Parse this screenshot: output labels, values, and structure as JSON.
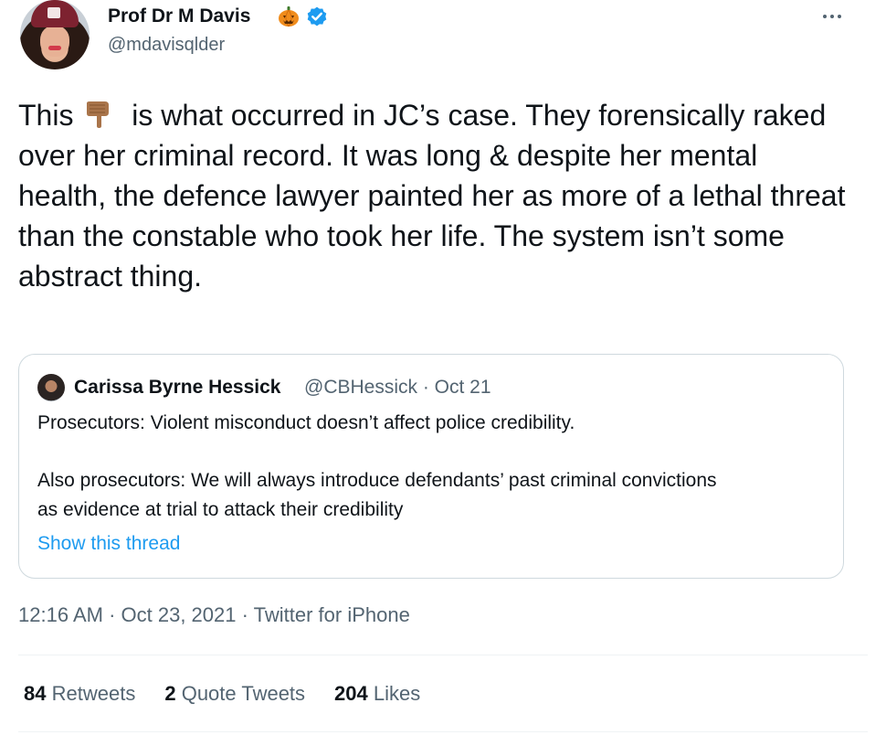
{
  "author": {
    "display_name": "Prof Dr M Davis",
    "handle": "@mdavisqlder",
    "badges": [
      "pumpkin-emoji",
      "verified-badge"
    ],
    "verified_color": "#1d9bf0"
  },
  "tweet": {
    "text_before_emoji": "This",
    "emoji": "backhand-index-pointing-down",
    "text_after_emoji": " is what occurred in JC’s case. They forensically raked over her criminal record. It was long & despite her mental health, the defence lawyer painted her as more of a lethal threat than the constable who took her life. The system isn’t some abstract thing."
  },
  "quoted_tweet": {
    "author_name": "Carissa Byrne Hessick",
    "meta": "@CBHessick · Oct 21",
    "line1": "Prosecutors: Violent misconduct doesn’t affect police credibility.",
    "line2": "Also prosecutors: We will always introduce defendants’ past criminal convictions",
    "line3": "as evidence at trial to attack their credibility",
    "show_thread": "Show this thread"
  },
  "meta": {
    "time": "12:16 AM",
    "date": "Oct 23, 2021",
    "source": "Twitter for iPhone",
    "separator": " · "
  },
  "stats": {
    "retweets_count": "84",
    "retweets_label": "Retweets",
    "quotes_count": "2",
    "quotes_label": "Quote Tweets",
    "likes_count": "204",
    "likes_label": "Likes"
  },
  "colors": {
    "text_primary": "#0f1419",
    "text_secondary": "#536471",
    "link": "#1d9bf0",
    "border": "#cfd9de"
  }
}
